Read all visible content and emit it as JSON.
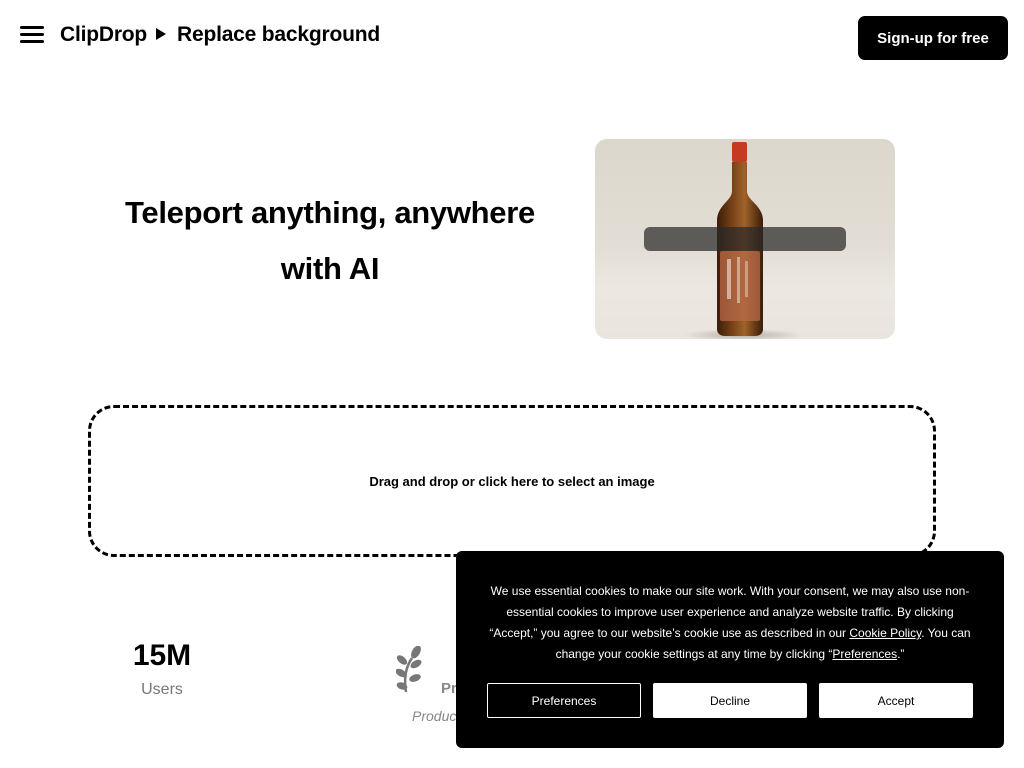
{
  "header": {
    "brand": "ClipDrop",
    "page": "Replace background",
    "signup_label": "Sign-up for free",
    "menu_icon": "hamburger-menu-icon",
    "breadcrumb_icon": "triangle-right-icon"
  },
  "hero": {
    "title_line1": "Teleport anything, anywhere",
    "title_line2": "with AI"
  },
  "dropzone": {
    "label": "Drag and drop or click here to select an image"
  },
  "stats": {
    "users_value": "15M",
    "users_label": "Users",
    "award_title_partial": "Pr",
    "award_sub_partial": "Produc",
    "award_icon": "laurel-icon"
  },
  "cookie": {
    "text_1": "We use essential cookies to make our site work. With your consent, we may also use non-essential cookies to improve user experience and analyze website traffic. By clicking “Accept,” you agree to our website’s cookie use as described in our ",
    "policy_link": "Cookie Policy",
    "text_2": ". You can change your cookie settings at any time by clicking “",
    "preferences_link": "Preferences",
    "text_3": ".”",
    "buttons": {
      "preferences": "Preferences",
      "decline": "Decline",
      "accept": "Accept"
    }
  }
}
